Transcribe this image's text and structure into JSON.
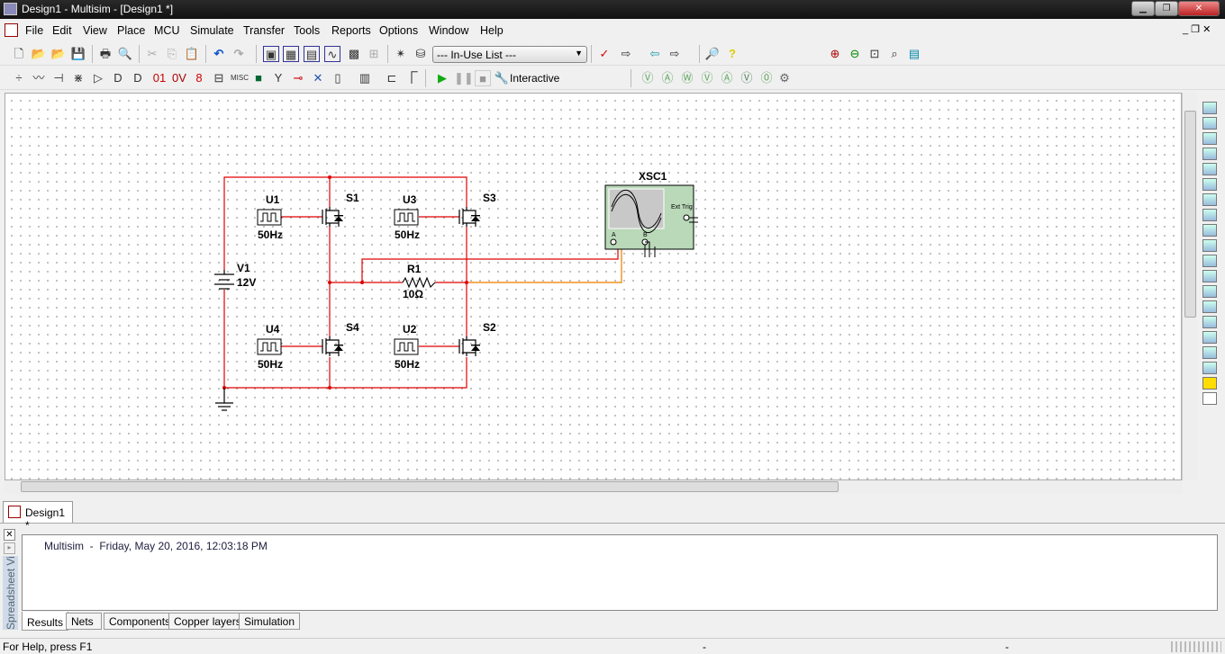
{
  "window": {
    "title": "Design1 - Multisim - [Design1 *]"
  },
  "menu": [
    "File",
    "Edit",
    "View",
    "Place",
    "MCU",
    "Simulate",
    "Transfer",
    "Tools",
    "Reports",
    "Options",
    "Window",
    "Help"
  ],
  "toolbar": {
    "in_use_list": "--- In-Use List ---",
    "interactive_label": "Interactive"
  },
  "schematic": {
    "components": [
      {
        "ref": "U1",
        "value": "50Hz"
      },
      {
        "ref": "U3",
        "value": "50Hz"
      },
      {
        "ref": "U4",
        "value": "50Hz"
      },
      {
        "ref": "U2",
        "value": "50Hz"
      },
      {
        "ref": "S1"
      },
      {
        "ref": "S3"
      },
      {
        "ref": "S4"
      },
      {
        "ref": "S2"
      },
      {
        "ref": "V1",
        "value": "12V"
      },
      {
        "ref": "R1",
        "value": "10Ω"
      }
    ],
    "scope": {
      "ref": "XSC1",
      "ext_trig": "Ext Trig",
      "ch_a": "A",
      "ch_b": "B"
    },
    "wire_color": "#e00000",
    "probe_color": "#f09020"
  },
  "tabs": {
    "design": "Design1 *"
  },
  "panel": {
    "side_label": "Spreadsheet View",
    "log": "Multisim  -  Friday, May 20, 2016, 12:03:18 PM",
    "tabs": [
      "Results",
      "Nets",
      "Components",
      "Copper layers",
      "Simulation"
    ]
  },
  "status": {
    "help": "For Help, press F1",
    "field2": "-",
    "field3": "-"
  }
}
